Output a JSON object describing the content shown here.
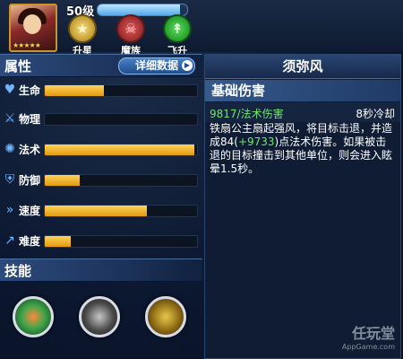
{
  "header": {
    "level": "50级",
    "xp_fraction": 0.92,
    "stars": "★★★★★"
  },
  "top_buttons": [
    {
      "label": "升星",
      "icon": "star-icon",
      "glyph": "★"
    },
    {
      "label": "魔族",
      "icon": "demon-icon",
      "glyph": "☠"
    },
    {
      "label": "飞升",
      "icon": "ascend-icon",
      "glyph": "↟"
    }
  ],
  "attributes": {
    "title": "属性",
    "detail_label": "详细数据",
    "detail_arrow": "▶"
  },
  "stats": [
    {
      "label": "生命",
      "icon": "heart-icon",
      "glyph": "♥",
      "level": 0.39
    },
    {
      "label": "物理",
      "icon": "sword-icon",
      "glyph": "⚔",
      "level": 0.0
    },
    {
      "label": "法术",
      "icon": "spell-icon",
      "glyph": "✺",
      "level": 0.98
    },
    {
      "label": "防御",
      "icon": "shield-icon",
      "glyph": "⛨",
      "level": 0.23
    },
    {
      "label": "速度",
      "icon": "boot-icon",
      "glyph": "»",
      "level": 0.67
    },
    {
      "label": "难度",
      "icon": "trend-icon",
      "glyph": "↗",
      "level": 0.17
    }
  ],
  "skills_title": "技能",
  "skill_detail": {
    "name": "须弥风",
    "category": "基础伤害",
    "damage": "9817/法术伤害",
    "cooldown": "8秒冷却",
    "desc_part1": "铁扇公主扇起强风，将目标击退，并造成84(",
    "desc_bonus": "+9733",
    "desc_part2": ")点法术伤害。如果被击退的目标撞击到其他单位，则会进入眩晕1.5秒。"
  },
  "watermark": {
    "main": "任玩堂",
    "sub": "AppGame.com"
  },
  "colors": {
    "accent_green": "#6ee86b",
    "bar_gold": "#e09a10"
  }
}
